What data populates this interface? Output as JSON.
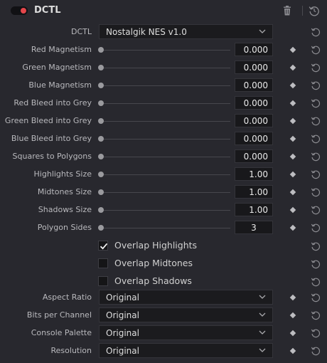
{
  "header": {
    "title": "DCTL"
  },
  "dctl": {
    "label": "DCTL",
    "value": "Nostalgik NES v1.0"
  },
  "sliders": [
    {
      "label": "Red Magnetism",
      "value": "0.000"
    },
    {
      "label": "Green Magnetism",
      "value": "0.000"
    },
    {
      "label": "Blue Magnetism",
      "value": "0.000"
    },
    {
      "label": "Red Bleed into Grey",
      "value": "0.000"
    },
    {
      "label": "Green Bleed into Grey",
      "value": "0.000"
    },
    {
      "label": "Blue Bleed into Grey",
      "value": "0.000"
    },
    {
      "label": "Squares to Polygons",
      "value": "0.000"
    },
    {
      "label": "Highlights Size",
      "value": "1.00"
    },
    {
      "label": "Midtones Size",
      "value": "1.00"
    },
    {
      "label": "Shadows Size",
      "value": "1.00"
    },
    {
      "label": "Polygon Sides",
      "value": "3"
    }
  ],
  "checkboxes": [
    {
      "label": "Overlap Highlights",
      "checked": true
    },
    {
      "label": "Overlap Midtones",
      "checked": false
    },
    {
      "label": "Overlap Shadows",
      "checked": false
    }
  ],
  "selects": [
    {
      "label": "Aspect Ratio",
      "value": "Original"
    },
    {
      "label": "Bits per Channel",
      "value": "Original"
    },
    {
      "label": "Console Palette",
      "value": "Original"
    },
    {
      "label": "Resolution",
      "value": "Original"
    }
  ],
  "colors": {
    "toggle_on": "#e4464b",
    "background": "#28282e"
  }
}
